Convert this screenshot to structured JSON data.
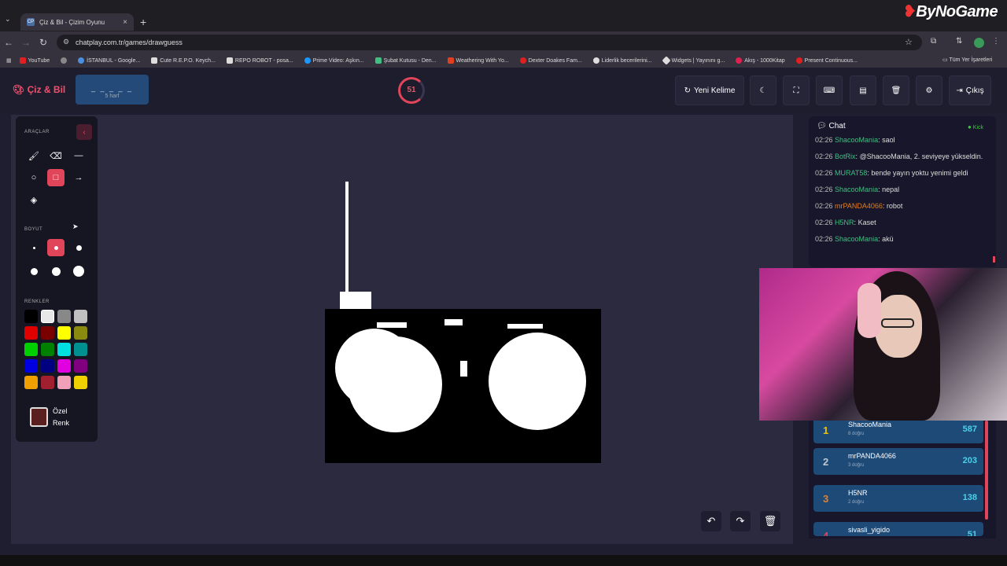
{
  "browser": {
    "tab_title": "Çiz & Bil - Çizim Oyunu",
    "tab_favicon": "CP",
    "url": "chatplay.com.tr/games/drawguess",
    "brand_watermark": "ByNoGame",
    "bookmarks": [
      {
        "label": "YouTube",
        "color": "#e02020"
      },
      {
        "label": "",
        "color": "#888888"
      },
      {
        "label": "İSTANBUL - Google...",
        "color": "#4a8fe0"
      },
      {
        "label": "Cute R.E.P.O. Keych...",
        "color": "#dddddd"
      },
      {
        "label": "REPO ROBOT - posa...",
        "color": "#dddddd"
      },
      {
        "label": "Prime Video: Aşkın...",
        "color": "#1a98ff"
      },
      {
        "label": "Şubat Kutusu - Den...",
        "color": "#40c080"
      },
      {
        "label": "Weathering With Yo...",
        "color": "#e04020"
      },
      {
        "label": "Dexter Doakes Fam...",
        "color": "#e02020"
      },
      {
        "label": "Liderlik becerilerini...",
        "color": "#dddddd"
      },
      {
        "label": "Widgets | Yayınını g...",
        "color": "#dddddd"
      },
      {
        "label": "Akış - 1000Kitap",
        "color": "#e02050"
      },
      {
        "label": "Present Continuous...",
        "color": "#e02020"
      }
    ],
    "all_bookmarks": "Tüm Yer İşaretleri"
  },
  "header": {
    "logo": "Çiz & Bil",
    "word_mask": "_ _ _ _ _",
    "word_hint": "5 harf",
    "timer": "51",
    "new_word": "Yeni Kelime",
    "exit": "Çıkış"
  },
  "tools": {
    "section_tools": "ARAÇLAR",
    "section_size": "BOYUT",
    "section_colors": "RENKLER",
    "custom_color": "Özel Renk",
    "custom_color_value": "#5a2020",
    "colors": [
      "#000000",
      "#e8e8e8",
      "#888888",
      "#c0c0c0",
      "#e00000",
      "#7a0000",
      "#ffff00",
      "#8a8a10",
      "#00d000",
      "#008000",
      "#00e0e0",
      "#009090",
      "#0000e0",
      "#000080",
      "#e000e0",
      "#800080",
      "#f0a000",
      "#a02030",
      "#f0a0b8",
      "#f0d000"
    ]
  },
  "chat": {
    "title": "Chat",
    "platform": "Kick",
    "messages": [
      {
        "time": "02:26",
        "user": "ShacooMania",
        "text": "saol",
        "color": "#40c080"
      },
      {
        "time": "02:26",
        "user": "BotRix",
        "text": "@ShacooMania, 2. seviyeye yükseldin.",
        "color": "#40c080"
      },
      {
        "time": "02:26",
        "user": "MURAT58",
        "text": "bende yayın yoktu yenimi geldi",
        "color": "#40c080"
      },
      {
        "time": "02:26",
        "user": "ShacooMania",
        "text": "nepal",
        "color": "#40c080"
      },
      {
        "time": "02:26",
        "user": "mrPANDA4066",
        "text": "robot",
        "color": "#e08020"
      },
      {
        "time": "02:26",
        "user": "H5NR",
        "text": "Kaset",
        "color": "#40c080"
      },
      {
        "time": "02:26",
        "user": "ShacooMania",
        "text": "akü",
        "color": "#40c080"
      }
    ]
  },
  "leaderboard": [
    {
      "rank": "1",
      "name": "ShacooMania",
      "sub": "8 doğru",
      "score": "587",
      "rank_color": "#f0c000"
    },
    {
      "rank": "2",
      "name": "mrPANDA4066",
      "sub": "3 doğru",
      "score": "203",
      "rank_color": "#c0c8d0"
    },
    {
      "rank": "3",
      "name": "H5NR",
      "sub": "2 doğru",
      "score": "138",
      "rank_color": "#e08030"
    },
    {
      "rank": "4",
      "name": "sivasli_yigido",
      "sub": "",
      "score": "51",
      "rank_color": "#e0455a"
    }
  ]
}
